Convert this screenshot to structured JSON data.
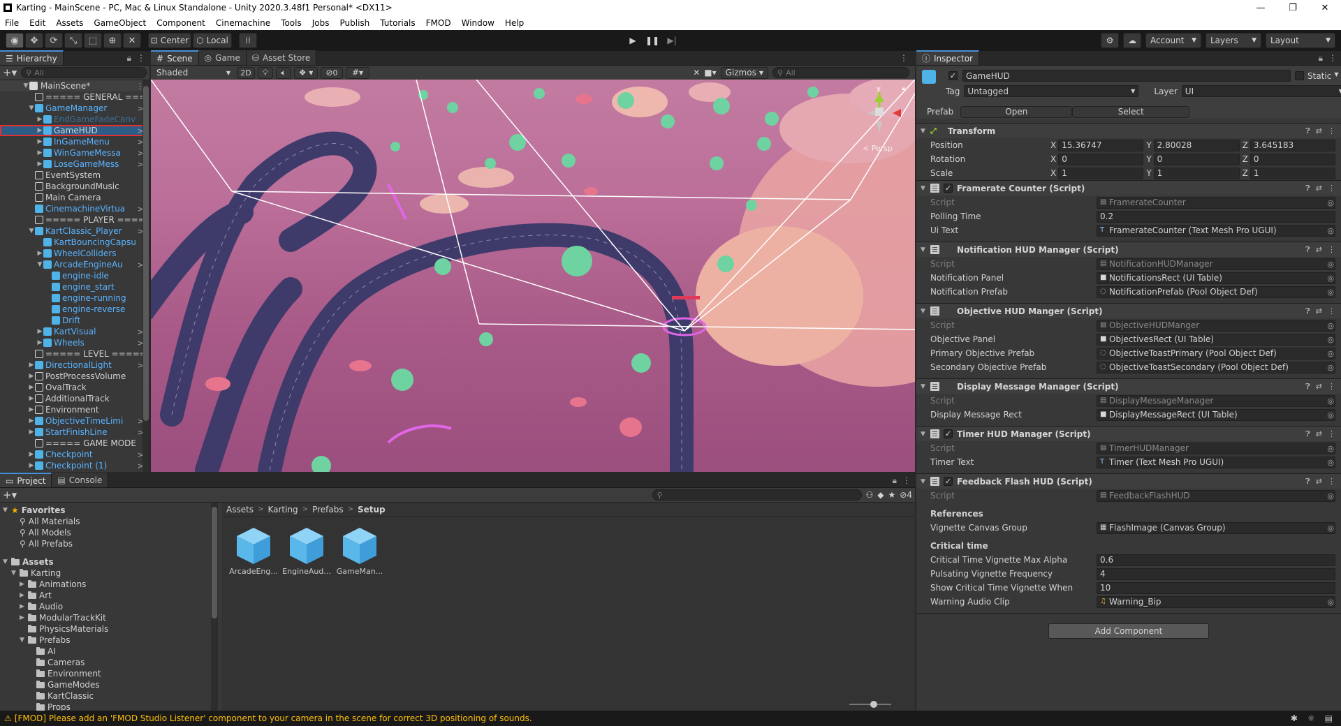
{
  "window": {
    "title": "Karting - MainScene - PC, Mac & Linux Standalone - Unity 2020.3.48f1 Personal* <DX11>",
    "controls": [
      "—",
      "❐",
      "✕"
    ]
  },
  "menu": [
    "File",
    "Edit",
    "Assets",
    "GameObject",
    "Component",
    "Cinemachine",
    "Tools",
    "Jobs",
    "Publish",
    "Tutorials",
    "FMOD",
    "Window",
    "Help"
  ],
  "toolbar": {
    "pivot": "Center",
    "space": "Local",
    "account": "Account",
    "layers": "Layers",
    "layout": "Layout"
  },
  "hierarchy": {
    "tab": "Hierarchy",
    "search_placeholder": "All",
    "scene": "MainScene*",
    "items": [
      {
        "label": "===== GENERAL ===",
        "indent": 1,
        "icon": "outline",
        "arrow": "",
        "chev": false
      },
      {
        "label": "GameManager",
        "indent": 1,
        "icon": "blue",
        "arrow": "▼",
        "chev": true,
        "color": "blue"
      },
      {
        "label": "EndGameFadeCanv",
        "indent": 2,
        "icon": "blue",
        "arrow": "▶",
        "chev": false,
        "color": "faded"
      },
      {
        "label": "GameHUD",
        "indent": 2,
        "icon": "blue",
        "arrow": "▶",
        "chev": true,
        "color": "white",
        "selected": true
      },
      {
        "label": "InGameMenu",
        "indent": 2,
        "icon": "blue",
        "arrow": "▶",
        "chev": true,
        "color": "blue"
      },
      {
        "label": "WinGameMessa",
        "indent": 2,
        "icon": "blue",
        "arrow": "▶",
        "chev": true,
        "color": "blue"
      },
      {
        "label": "LoseGameMess",
        "indent": 2,
        "icon": "blue",
        "arrow": "▶",
        "chev": true,
        "color": "blue"
      },
      {
        "label": "EventSystem",
        "indent": 1,
        "icon": "outline",
        "arrow": "",
        "chev": false
      },
      {
        "label": "BackgroundMusic",
        "indent": 1,
        "icon": "outline",
        "arrow": "",
        "chev": false
      },
      {
        "label": "Main Camera",
        "indent": 1,
        "icon": "outline",
        "arrow": "",
        "chev": false
      },
      {
        "label": "CinemachineVirtua",
        "indent": 1,
        "icon": "blue",
        "arrow": "",
        "chev": true,
        "color": "blue"
      },
      {
        "label": "===== PLAYER ====",
        "indent": 1,
        "icon": "outline",
        "arrow": "",
        "chev": false
      },
      {
        "label": "KartClassic_Player",
        "indent": 1,
        "icon": "blue",
        "arrow": "▼",
        "chev": true,
        "color": "blue"
      },
      {
        "label": "KartBouncingCapsu",
        "indent": 2,
        "icon": "blue",
        "arrow": "",
        "chev": false,
        "color": "blue"
      },
      {
        "label": "WheelColliders",
        "indent": 2,
        "icon": "blue",
        "arrow": "▶",
        "chev": false,
        "color": "blue"
      },
      {
        "label": "ArcadeEngineAu",
        "indent": 2,
        "icon": "blue",
        "arrow": "▼",
        "chev": true,
        "color": "blue"
      },
      {
        "label": "engine-idle",
        "indent": 3,
        "icon": "blue",
        "arrow": "",
        "chev": false,
        "color": "blue"
      },
      {
        "label": "engine_start",
        "indent": 3,
        "icon": "blue",
        "arrow": "",
        "chev": false,
        "color": "blue"
      },
      {
        "label": "engine-running",
        "indent": 3,
        "icon": "blue",
        "arrow": "",
        "chev": false,
        "color": "blue"
      },
      {
        "label": "engine-reverse",
        "indent": 3,
        "icon": "blue",
        "arrow": "",
        "chev": false,
        "color": "blue"
      },
      {
        "label": "Drift",
        "indent": 3,
        "icon": "blue",
        "arrow": "",
        "chev": false,
        "color": "blue"
      },
      {
        "label": "KartVisual",
        "indent": 2,
        "icon": "blue",
        "arrow": "▶",
        "chev": true,
        "color": "blue"
      },
      {
        "label": "Wheels",
        "indent": 2,
        "icon": "blue",
        "arrow": "▶",
        "chev": true,
        "color": "blue"
      },
      {
        "label": "===== LEVEL =====",
        "indent": 1,
        "icon": "outline",
        "arrow": "",
        "chev": false
      },
      {
        "label": "DirectionalLight",
        "indent": 1,
        "icon": "blue",
        "arrow": "▶",
        "chev": true,
        "color": "blue"
      },
      {
        "label": "PostProcessVolume",
        "indent": 1,
        "icon": "outline",
        "arrow": "▶",
        "chev": false
      },
      {
        "label": "OvalTrack",
        "indent": 1,
        "icon": "outline",
        "arrow": "▶",
        "chev": false
      },
      {
        "label": "AdditionalTrack",
        "indent": 1,
        "icon": "outline",
        "arrow": "▶",
        "chev": false
      },
      {
        "label": "Environment",
        "indent": 1,
        "icon": "outline",
        "arrow": "▶",
        "chev": false
      },
      {
        "label": "ObjectiveTimeLimi",
        "indent": 1,
        "icon": "blue",
        "arrow": "▶",
        "chev": true,
        "color": "blue"
      },
      {
        "label": "StartFinishLine",
        "indent": 1,
        "icon": "blue",
        "arrow": "▶",
        "chev": true,
        "color": "blue"
      },
      {
        "label": "===== GAME MODE",
        "indent": 1,
        "icon": "outline",
        "arrow": "",
        "chev": false
      },
      {
        "label": "Checkpoint",
        "indent": 1,
        "icon": "blue",
        "arrow": "▶",
        "chev": true,
        "color": "blue"
      },
      {
        "label": "Checkpoint (1)",
        "indent": 1,
        "icon": "blue",
        "arrow": "▶",
        "chev": true,
        "color": "blue"
      }
    ]
  },
  "scene": {
    "tabs": [
      "Scene",
      "Game",
      "Asset Store"
    ],
    "shading": "Shaded",
    "mode2d": "2D",
    "fx_count": "0",
    "gizmos": "Gizmos",
    "search_placeholder": "All",
    "persp": "< Persp",
    "axis_y": "y"
  },
  "inspector": {
    "tab": "Inspector",
    "object_name": "GameHUD",
    "static_label": "Static",
    "tag_label": "Tag",
    "tag_value": "Untagged",
    "layer_label": "Layer",
    "layer_value": "UI",
    "prefab_label": "Prefab",
    "open": "Open",
    "select": "Select",
    "transform": {
      "title": "Transform",
      "rows": [
        {
          "label": "Position",
          "x": "15.36747",
          "y": "2.80028",
          "z": "3.645183"
        },
        {
          "label": "Rotation",
          "x": "0",
          "y": "0",
          "z": "0"
        },
        {
          "label": "Scale",
          "x": "1",
          "y": "1",
          "z": "1"
        }
      ]
    },
    "components": [
      {
        "title": "Framerate Counter (Script)",
        "check": true,
        "rows": [
          {
            "label": "Script",
            "value": "FramerateCounter",
            "dim": true,
            "icon": "script",
            "target": true
          },
          {
            "label": "Polling Time",
            "value": "0.2"
          },
          {
            "label": "Ui Text",
            "value": "FramerateCounter (Text Mesh Pro UGUI)",
            "icon": "text",
            "target": true
          }
        ]
      },
      {
        "title": "Notification HUD Manager (Script)",
        "check": false,
        "rows": [
          {
            "label": "Script",
            "value": "NotificationHUDManager",
            "dim": true,
            "icon": "script",
            "target": true
          },
          {
            "label": "Notification Panel",
            "value": "NotificationsRect (UI Table)",
            "icon": "doc",
            "target": true
          },
          {
            "label": "Notification Prefab",
            "value": "NotificationPrefab (Pool Object Def)",
            "icon": "pool",
            "target": true
          }
        ]
      },
      {
        "title": "Objective HUD Manger (Script)",
        "check": false,
        "rows": [
          {
            "label": "Script",
            "value": "ObjectiveHUDManger",
            "dim": true,
            "icon": "script",
            "target": true
          },
          {
            "label": "Objective Panel",
            "value": "ObjectivesRect (UI Table)",
            "icon": "doc",
            "target": true
          },
          {
            "label": "Primary Objective Prefab",
            "value": "ObjectiveToastPrimary (Pool Object Def)",
            "icon": "pool",
            "target": true
          },
          {
            "label": "Secondary Objective Prefab",
            "value": "ObjectiveToastSecondary (Pool Object Def)",
            "icon": "pool",
            "target": true
          }
        ]
      },
      {
        "title": "Display Message Manager (Script)",
        "check": false,
        "rows": [
          {
            "label": "Script",
            "value": "DisplayMessageManager",
            "dim": true,
            "icon": "script",
            "target": true
          },
          {
            "label": "Display Message Rect",
            "value": "DisplayMessageRect (UI Table)",
            "icon": "doc",
            "target": true
          }
        ]
      },
      {
        "title": "Timer HUD Manager (Script)",
        "check": true,
        "rows": [
          {
            "label": "Script",
            "value": "TimerHUDManager",
            "dim": true,
            "icon": "script",
            "target": true
          },
          {
            "label": "Timer Text",
            "value": "Timer (Text Mesh Pro UGUI)",
            "icon": "text",
            "target": true
          }
        ]
      },
      {
        "title": "Feedback Flash HUD (Script)",
        "check": true,
        "rows": [
          {
            "label": "Script",
            "value": "FeedbackFlashHUD",
            "dim": true,
            "icon": "script",
            "target": true
          },
          {
            "header": "References"
          },
          {
            "label": "Vignette Canvas Group",
            "value": "FlashImage (Canvas Group)",
            "icon": "grid",
            "target": true
          },
          {
            "header": "Critical time"
          },
          {
            "label": "Critical Time Vignette Max Alpha",
            "value": "0.6"
          },
          {
            "label": "Pulsating Vignette Frequency",
            "value": "4"
          },
          {
            "label": "Show Critical Time Vignette When",
            "value": "10"
          },
          {
            "label": "Warning Audio Clip",
            "value": "Warning_Bip",
            "icon": "audio",
            "target": true
          }
        ]
      }
    ],
    "add_component": "Add Component"
  },
  "project": {
    "tabs": [
      "Project",
      "Console"
    ],
    "hidden_count": "4",
    "breadcrumb": [
      "Assets",
      "Karting",
      "Prefabs",
      "Setup"
    ],
    "tree": [
      {
        "label": "Favorites",
        "indent": 0,
        "type": "star",
        "arrow": "▼",
        "bold": true
      },
      {
        "label": "All Materials",
        "indent": 1,
        "type": "search"
      },
      {
        "label": "All Models",
        "indent": 1,
        "type": "search"
      },
      {
        "label": "All Prefabs",
        "indent": 1,
        "type": "search"
      },
      {
        "label": "",
        "indent": 0,
        "type": "gap"
      },
      {
        "label": "Assets",
        "indent": 0,
        "type": "folder",
        "arrow": "▼",
        "bold": true
      },
      {
        "label": "Karting",
        "indent": 1,
        "type": "folder",
        "arrow": "▼"
      },
      {
        "label": "Animations",
        "indent": 2,
        "type": "folder",
        "arrow": "▶"
      },
      {
        "label": "Art",
        "indent": 2,
        "type": "folder",
        "arrow": "▶"
      },
      {
        "label": "Audio",
        "indent": 2,
        "type": "folder",
        "arrow": "▶"
      },
      {
        "label": "ModularTrackKit",
        "indent": 2,
        "type": "folder",
        "arrow": "▶"
      },
      {
        "label": "PhysicsMaterials",
        "indent": 2,
        "type": "folder",
        "arrow": ""
      },
      {
        "label": "Prefabs",
        "indent": 2,
        "type": "folder",
        "arrow": "▼"
      },
      {
        "label": "AI",
        "indent": 3,
        "type": "folder",
        "arrow": ""
      },
      {
        "label": "Cameras",
        "indent": 3,
        "type": "folder",
        "arrow": ""
      },
      {
        "label": "Environment",
        "indent": 3,
        "type": "folder",
        "arrow": ""
      },
      {
        "label": "GameModes",
        "indent": 3,
        "type": "folder",
        "arrow": ""
      },
      {
        "label": "KartClassic",
        "indent": 3,
        "type": "folder",
        "arrow": ""
      },
      {
        "label": "Props",
        "indent": 3,
        "type": "folder",
        "arrow": ""
      }
    ],
    "assets": [
      "ArcadeEng...",
      "EngineAud...",
      "GameMan..."
    ]
  },
  "status": {
    "message": "[FMOD] Please add an 'FMOD Studio Listener' component to your camera in the scene for correct 3D positioning of sounds."
  },
  "colors": {
    "accent": "#2c5d87",
    "prefab_blue": "#59b3ff",
    "scene_bg": "#b86b96",
    "track": "#3f3c6b",
    "warning": "#ffc107"
  }
}
